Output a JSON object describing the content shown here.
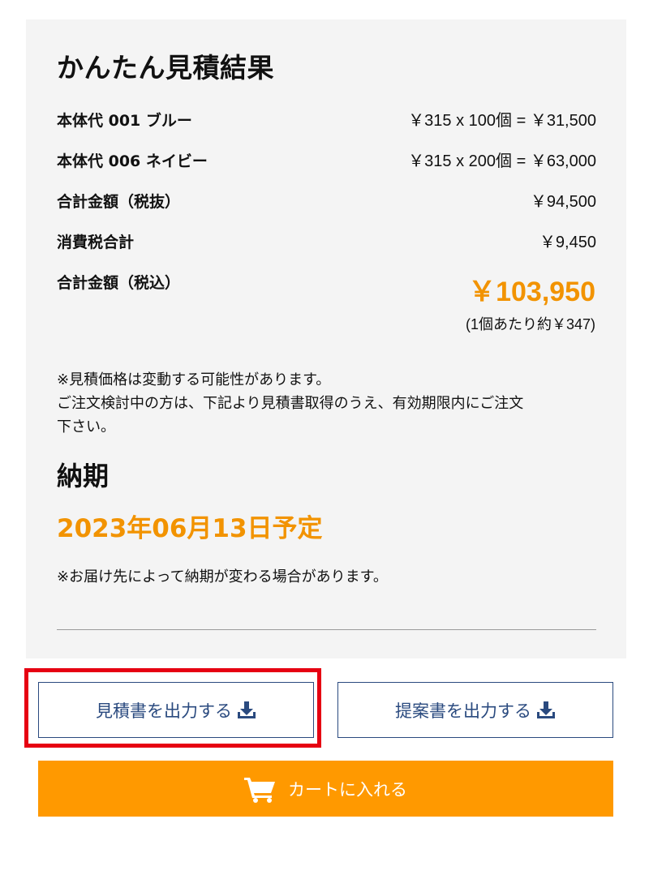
{
  "estimate": {
    "title": "かんたん見積結果",
    "rows": [
      {
        "label": "本体代 001 ブルー",
        "value": "￥315 x 100個 = ￥31,500"
      },
      {
        "label": "本体代 006 ネイビー",
        "value": "￥315 x 200個 = ￥63,000"
      },
      {
        "label": "合計金額（税抜）",
        "value": "￥94,500"
      },
      {
        "label": "消費税合計",
        "value": "￥9,450"
      }
    ],
    "total_label": "合計金額（税込）",
    "total_value": "￥103,950",
    "unit_price_note": "(1個あたり約￥347)",
    "notice_lines": [
      "※見積価格は変動する可能性があります。",
      "ご注文検討中の方は、下記より見積書取得のうえ、有効期限内にご注文",
      "下さい。"
    ]
  },
  "delivery": {
    "heading": "納期",
    "date": "2023年06月13日予定",
    "note": "※お届け先によって納期が変わる場合があります。"
  },
  "actions": {
    "estimate_pdf_label": "見積書を出力する",
    "proposal_pdf_label": "提案書を出力する",
    "download_icon": "download-icon",
    "cart_label": "カートに入れる",
    "cart_icon": "cart-icon"
  },
  "colors": {
    "accent_orange": "#f29300",
    "cart_button": "#ff9900",
    "button_border": "#2a4a7f",
    "highlight": "#e60012",
    "panel_bg": "#f4f4f4"
  }
}
